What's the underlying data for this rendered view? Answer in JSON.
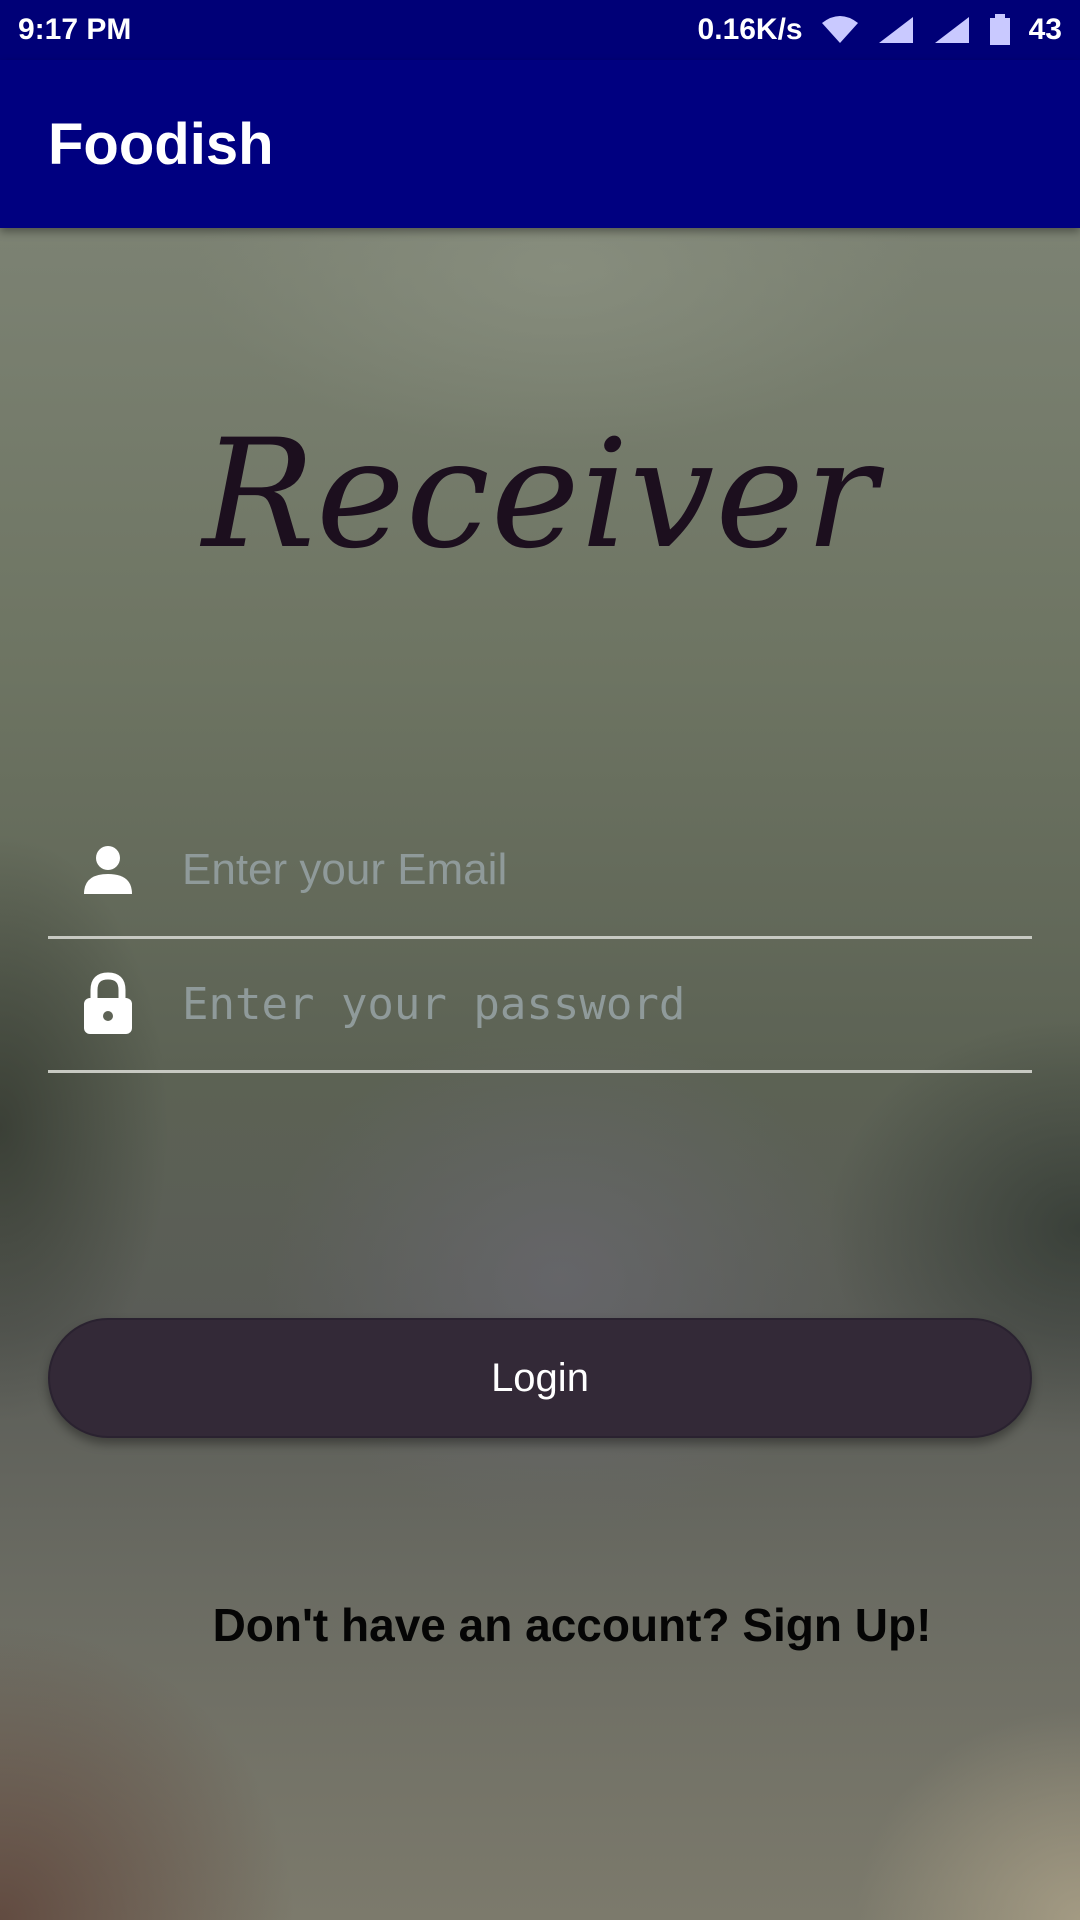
{
  "status_bar": {
    "time": "9:17 PM",
    "network_speed": "0.16K/s",
    "battery_level": "43",
    "icons": [
      "wifi-icon",
      "signal-icon",
      "signal-icon",
      "battery-icon"
    ]
  },
  "app_bar": {
    "title": "Foodish",
    "color": "#000080"
  },
  "login": {
    "heading": "Receiver",
    "email": {
      "icon": "person-icon",
      "value": "",
      "placeholder": "Enter your Email"
    },
    "password": {
      "icon": "lock-icon",
      "value": "",
      "placeholder": "Enter your password"
    },
    "login_button_label": "Login",
    "login_button_color": "#332937",
    "signup_link": "Don't have an account? Sign Up!"
  }
}
